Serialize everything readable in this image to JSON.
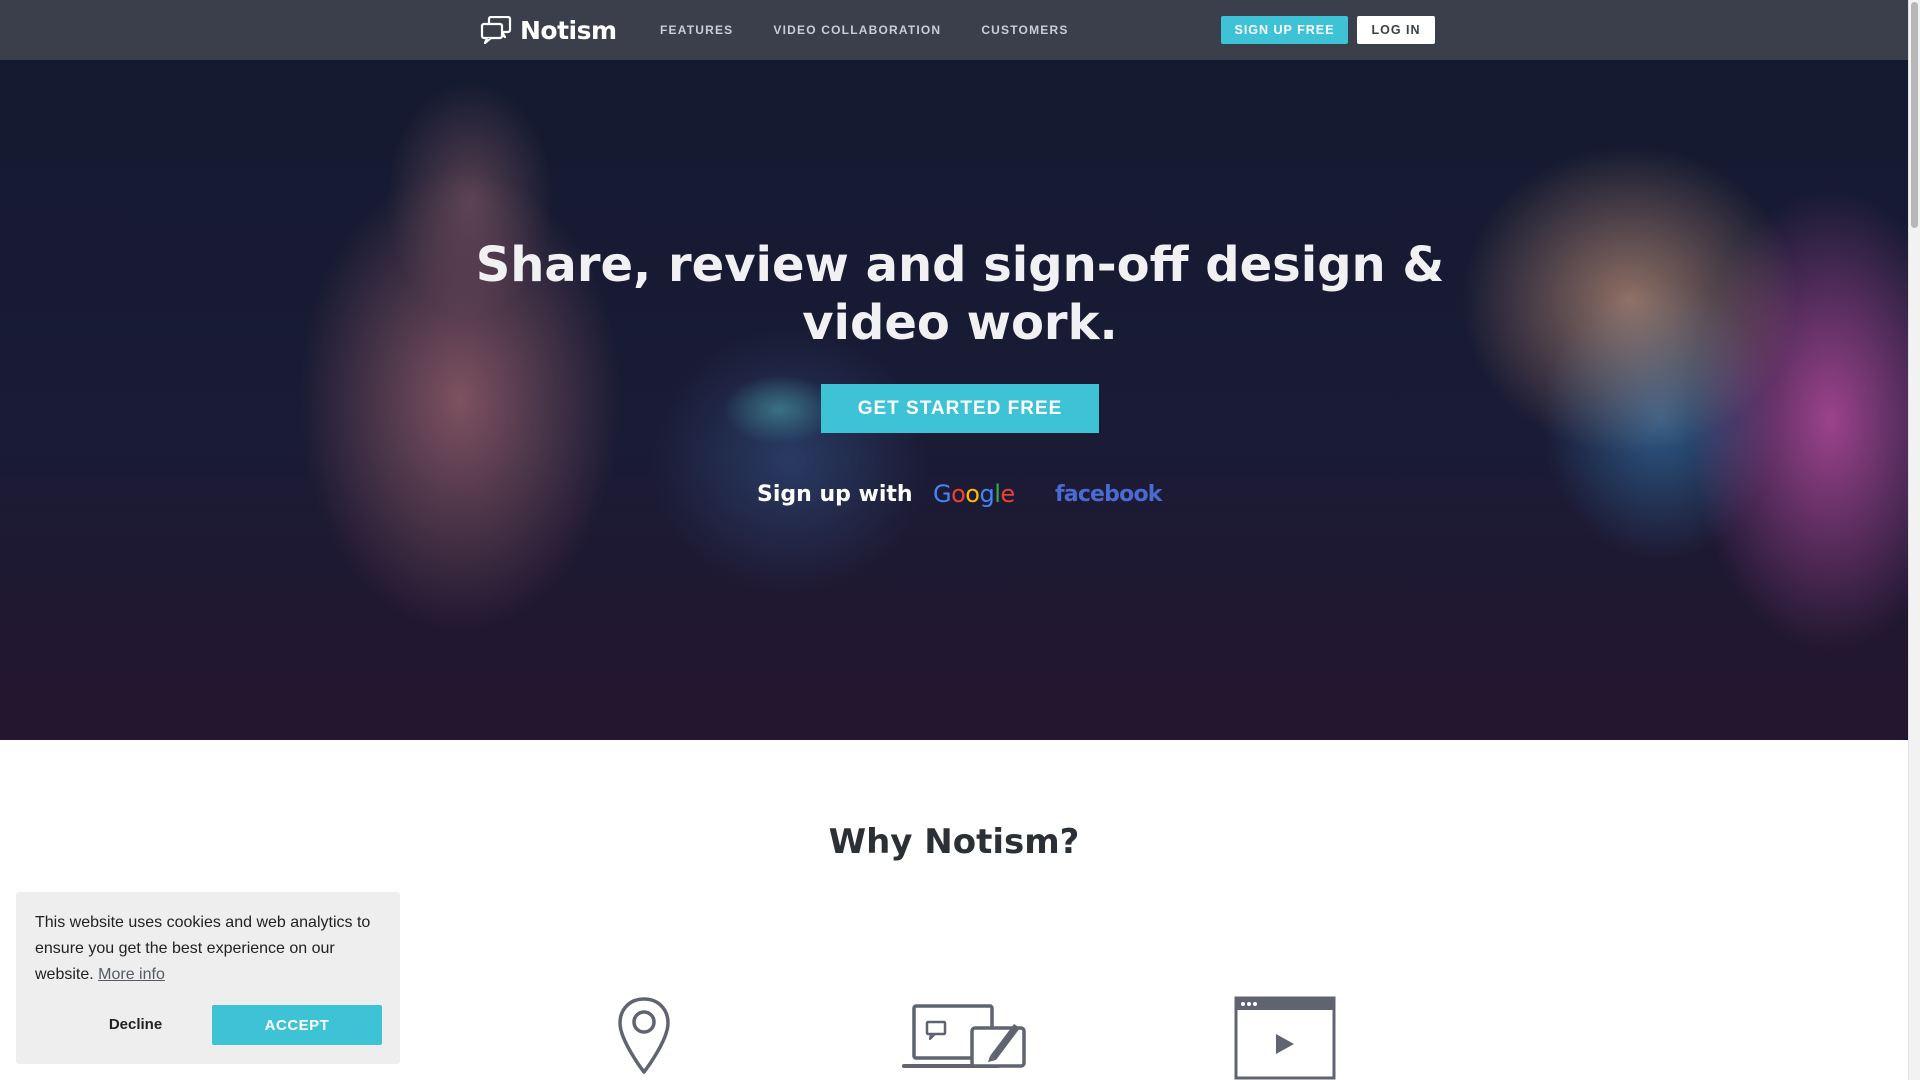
{
  "nav": {
    "logo_text": "Notism",
    "links": [
      "FEATURES",
      "VIDEO COLLABORATION",
      "CUSTOMERS"
    ],
    "signup_label": "SIGN UP FREE",
    "login_label": "LOG IN"
  },
  "hero": {
    "title_line1": "Share, review and sign-off design &",
    "title_line2": "video work.",
    "cta_label": "GET STARTED FREE",
    "signup_with": "Sign up with",
    "google": [
      "G",
      "o",
      "o",
      "g",
      "l",
      "e"
    ],
    "facebook": "facebook"
  },
  "why": {
    "title": "Why Notism?",
    "icons": [
      "map-pin-icon",
      "devices-comment-icon",
      "video-player-icon"
    ]
  },
  "cookie": {
    "text": "This website uses cookies and web analytics to ensure you get the best experience on our website.",
    "more_info": "More info",
    "decline_label": "Decline",
    "accept_label": "ACCEPT"
  },
  "colors": {
    "nav_bg": "#3a3f4b",
    "accent": "#3ec2d6",
    "facebook_blue": "#4a6bd0",
    "google_blue": "#4285f4",
    "google_red": "#ea4335",
    "google_yellow": "#fbbc05",
    "google_green": "#34a853"
  }
}
